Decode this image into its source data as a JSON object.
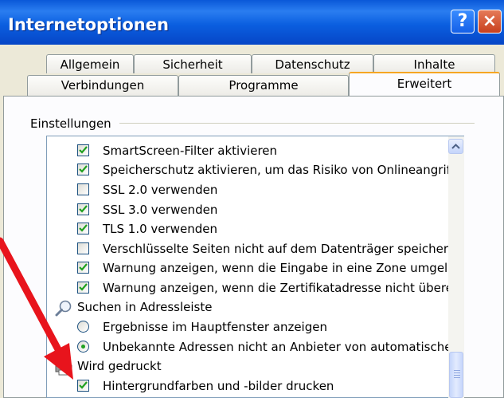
{
  "window": {
    "title": "Internetoptionen",
    "help_label": "?",
    "close_label": "×"
  },
  "tabs_row1": [
    "Allgemein",
    "Sicherheit",
    "Datenschutz",
    "Inhalte"
  ],
  "tabs_row2": [
    "Verbindungen",
    "Programme",
    "Erweitert"
  ],
  "active_tab": "Erweitert",
  "group": {
    "label": "Einstellungen"
  },
  "settings": [
    {
      "type": "checkbox",
      "checked": true,
      "label": "SmartScreen-Filter aktivieren"
    },
    {
      "type": "checkbox",
      "checked": true,
      "label": "Speicherschutz aktivieren, um das Risiko von Onlineangriff"
    },
    {
      "type": "checkbox",
      "checked": false,
      "label": "SSL 2.0 verwenden"
    },
    {
      "type": "checkbox",
      "checked": true,
      "label": "SSL 3.0 verwenden"
    },
    {
      "type": "checkbox",
      "checked": true,
      "label": "TLS 1.0 verwenden"
    },
    {
      "type": "checkbox",
      "checked": false,
      "label": "Verschlüsselte Seiten nicht auf dem Datenträger speichern"
    },
    {
      "type": "checkbox",
      "checked": true,
      "label": "Warnung anzeigen, wenn die Eingabe in eine Zone umgele"
    },
    {
      "type": "checkbox",
      "checked": true,
      "label": "Warnung anzeigen, wenn die Zertifikatadresse nicht übere"
    },
    {
      "type": "category",
      "icon": "search-icon",
      "label": "Suchen in Adressleiste"
    },
    {
      "type": "radio",
      "checked": false,
      "label": "Ergebnisse im Hauptfenster anzeigen"
    },
    {
      "type": "radio",
      "checked": true,
      "label": "Unbekannte Adressen nicht an Anbieter von automatische"
    },
    {
      "type": "category",
      "icon": "printer-icon",
      "label": "Wird gedruckt"
    },
    {
      "type": "checkbox",
      "checked": true,
      "label": "Hintergrundfarben und -bilder drucken"
    }
  ],
  "colors": {
    "title_blue": "#0a58d8",
    "check_green": "#21a121",
    "annotation_arrow": "#e8141c"
  }
}
